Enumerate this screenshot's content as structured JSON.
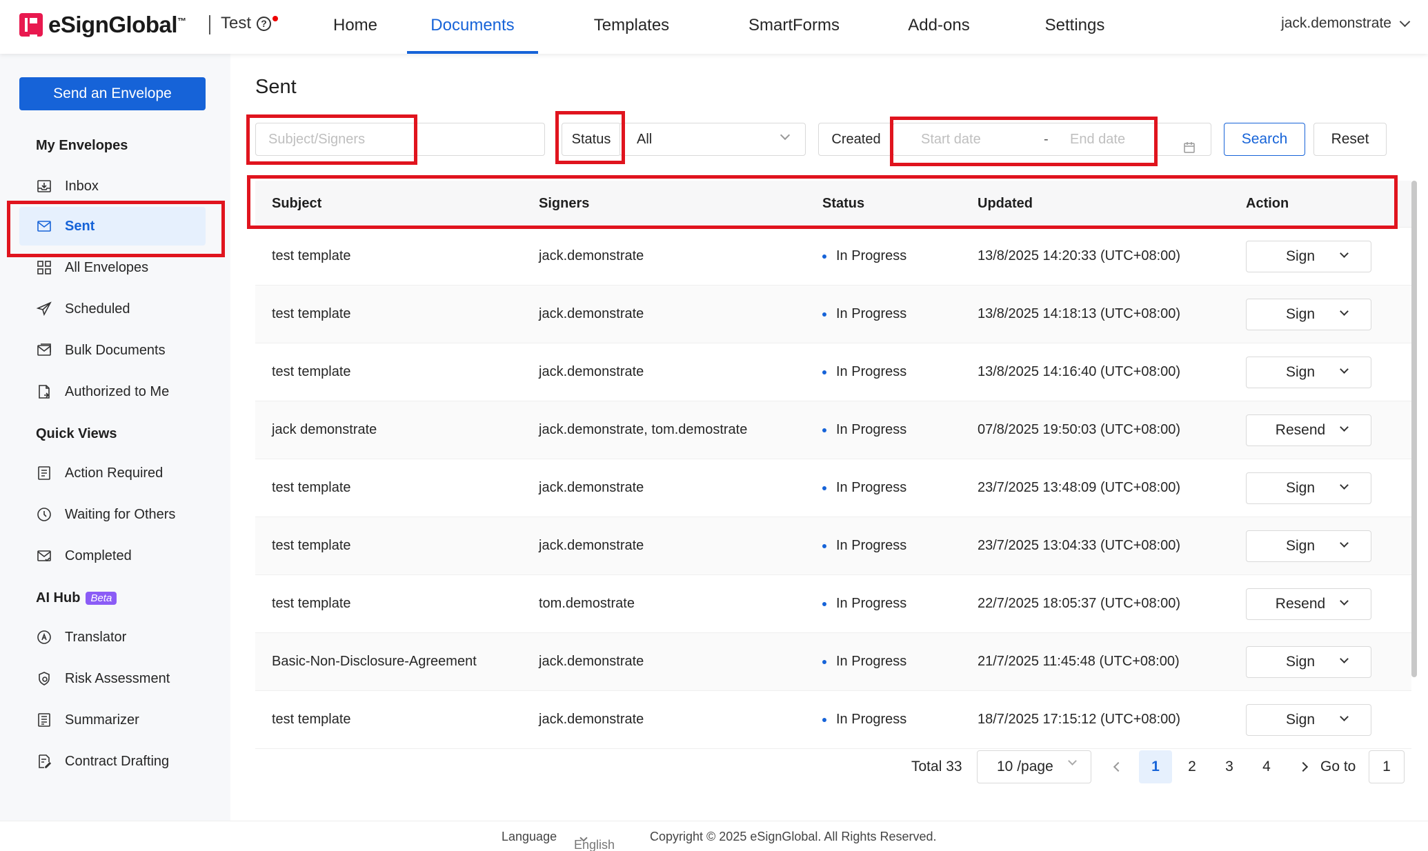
{
  "brand": {
    "name": "eSignGlobal",
    "tm": "™"
  },
  "org": {
    "name": "Test"
  },
  "nav": {
    "items": [
      {
        "label": "Home"
      },
      {
        "label": "Documents"
      },
      {
        "label": "Templates"
      },
      {
        "label": "SmartForms"
      },
      {
        "label": "Add-ons"
      },
      {
        "label": "Settings"
      }
    ],
    "active": "Documents"
  },
  "user": {
    "name": "jack.demonstrate"
  },
  "sidebar": {
    "send_button": "Send an Envelope",
    "my_envelopes": {
      "heading": "My Envelopes",
      "items": [
        {
          "label": "Inbox",
          "icon": "inbox-icon"
        },
        {
          "label": "Sent",
          "icon": "sent-icon"
        },
        {
          "label": "All Envelopes",
          "icon": "grid-icon"
        },
        {
          "label": "Scheduled",
          "icon": "paper-plane-icon"
        },
        {
          "label": "Bulk Documents",
          "icon": "bulk-mail-icon"
        },
        {
          "label": "Authorized to Me",
          "icon": "document-share-icon"
        }
      ]
    },
    "quick_views": {
      "heading": "Quick Views",
      "items": [
        {
          "label": "Action Required",
          "icon": "task-list-icon"
        },
        {
          "label": "Waiting for Others",
          "icon": "clock-icon"
        },
        {
          "label": "Completed",
          "icon": "mail-check-icon"
        }
      ]
    },
    "ai_hub": {
      "heading": "AI Hub",
      "badge": "Beta",
      "items": [
        {
          "label": "Translator",
          "icon": "translate-icon"
        },
        {
          "label": "Risk Assessment",
          "icon": "shield-icon"
        },
        {
          "label": "Summarizer",
          "icon": "summary-icon"
        },
        {
          "label": "Contract Drafting",
          "icon": "edit-document-icon"
        }
      ]
    },
    "active_item": "Sent"
  },
  "page": {
    "title": "Sent"
  },
  "filters": {
    "subject_placeholder": "Subject/Signers",
    "status_label": "Status",
    "status_value": "All",
    "created_label": "Created",
    "start_placeholder": "Start date",
    "range_separator": "-",
    "end_placeholder": "End date",
    "search_button": "Search",
    "reset_button": "Reset"
  },
  "table": {
    "headers": {
      "subject": "Subject",
      "signers": "Signers",
      "status": "Status",
      "updated": "Updated",
      "action": "Action"
    },
    "rows": [
      {
        "subject": "test template",
        "signers": "jack.demonstrate",
        "status": "In Progress",
        "updated": "13/8/2025 14:20:33 (UTC+08:00)",
        "action": "Sign"
      },
      {
        "subject": "test template",
        "signers": "jack.demonstrate",
        "status": "In Progress",
        "updated": "13/8/2025 14:18:13 (UTC+08:00)",
        "action": "Sign"
      },
      {
        "subject": "test template",
        "signers": "jack.demonstrate",
        "status": "In Progress",
        "updated": "13/8/2025 14:16:40 (UTC+08:00)",
        "action": "Sign"
      },
      {
        "subject": "jack demonstrate",
        "signers": "jack.demonstrate, tom.demostrate",
        "status": "In Progress",
        "updated": "07/8/2025 19:50:03 (UTC+08:00)",
        "action": "Resend"
      },
      {
        "subject": "test template",
        "signers": "jack.demonstrate",
        "status": "In Progress",
        "updated": "23/7/2025 13:48:09 (UTC+08:00)",
        "action": "Sign"
      },
      {
        "subject": "test template",
        "signers": "jack.demonstrate",
        "status": "In Progress",
        "updated": "23/7/2025 13:04:33 (UTC+08:00)",
        "action": "Sign"
      },
      {
        "subject": "test template",
        "signers": "tom.demostrate",
        "status": "In Progress",
        "updated": "22/7/2025 18:05:37 (UTC+08:00)",
        "action": "Resend"
      },
      {
        "subject": "Basic-Non-Disclosure-Agreement",
        "signers": "jack.demonstrate",
        "status": "In Progress",
        "updated": "21/7/2025 11:45:48 (UTC+08:00)",
        "action": "Sign"
      },
      {
        "subject": "test template",
        "signers": "jack.demonstrate",
        "status": "In Progress",
        "updated": "18/7/2025 17:15:12 (UTC+08:00)",
        "action": "Sign"
      }
    ]
  },
  "pagination": {
    "total": "Total 33",
    "page_size": "10 /page",
    "pages": [
      "1",
      "2",
      "3",
      "4"
    ],
    "current": "1",
    "goto_label": "Go to",
    "goto_value": "1"
  },
  "footer": {
    "language_label": "Language",
    "language_value": "English",
    "copyright": "Copyright © 2025 eSignGlobal. All Rights Reserved."
  },
  "colors": {
    "accent": "#1663d8",
    "highlight": "#e0141e",
    "brand": "#e8194f",
    "beta": "#8b5cf6"
  }
}
